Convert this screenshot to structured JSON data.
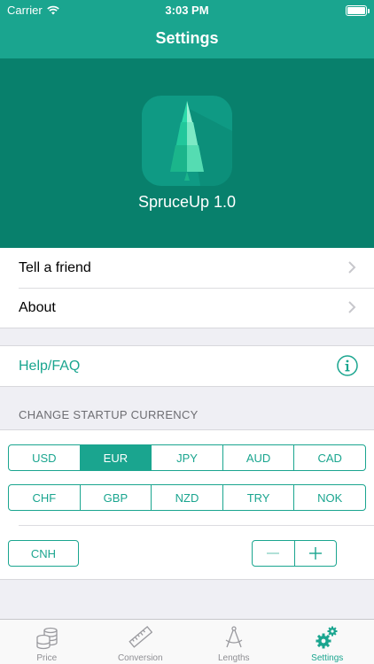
{
  "status_bar": {
    "carrier": "Carrier",
    "time": "3:03 PM"
  },
  "nav": {
    "title": "Settings"
  },
  "hero": {
    "app_name": "SpruceUp 1.0"
  },
  "menu": {
    "tell_a_friend": "Tell a friend",
    "about": "About",
    "help": "Help/FAQ"
  },
  "currency": {
    "section_header": "CHANGE STARTUP CURRENCY",
    "row1": [
      "USD",
      "EUR",
      "JPY",
      "AUD",
      "CAD"
    ],
    "row2": [
      "CHF",
      "GBP",
      "NZD",
      "TRY",
      "NOK"
    ],
    "extra": "CNH",
    "selected": "EUR"
  },
  "tabs": [
    {
      "label": "Price",
      "icon": "coins-icon",
      "active": false
    },
    {
      "label": "Conversion",
      "icon": "ruler-icon",
      "active": false
    },
    {
      "label": "Lengths",
      "icon": "compass-icon",
      "active": false
    },
    {
      "label": "Settings",
      "icon": "gears-icon",
      "active": true
    }
  ],
  "colors": {
    "accent": "#1aa58f",
    "hero_background": "#08806c",
    "tab_inactive": "#8e8e93"
  }
}
